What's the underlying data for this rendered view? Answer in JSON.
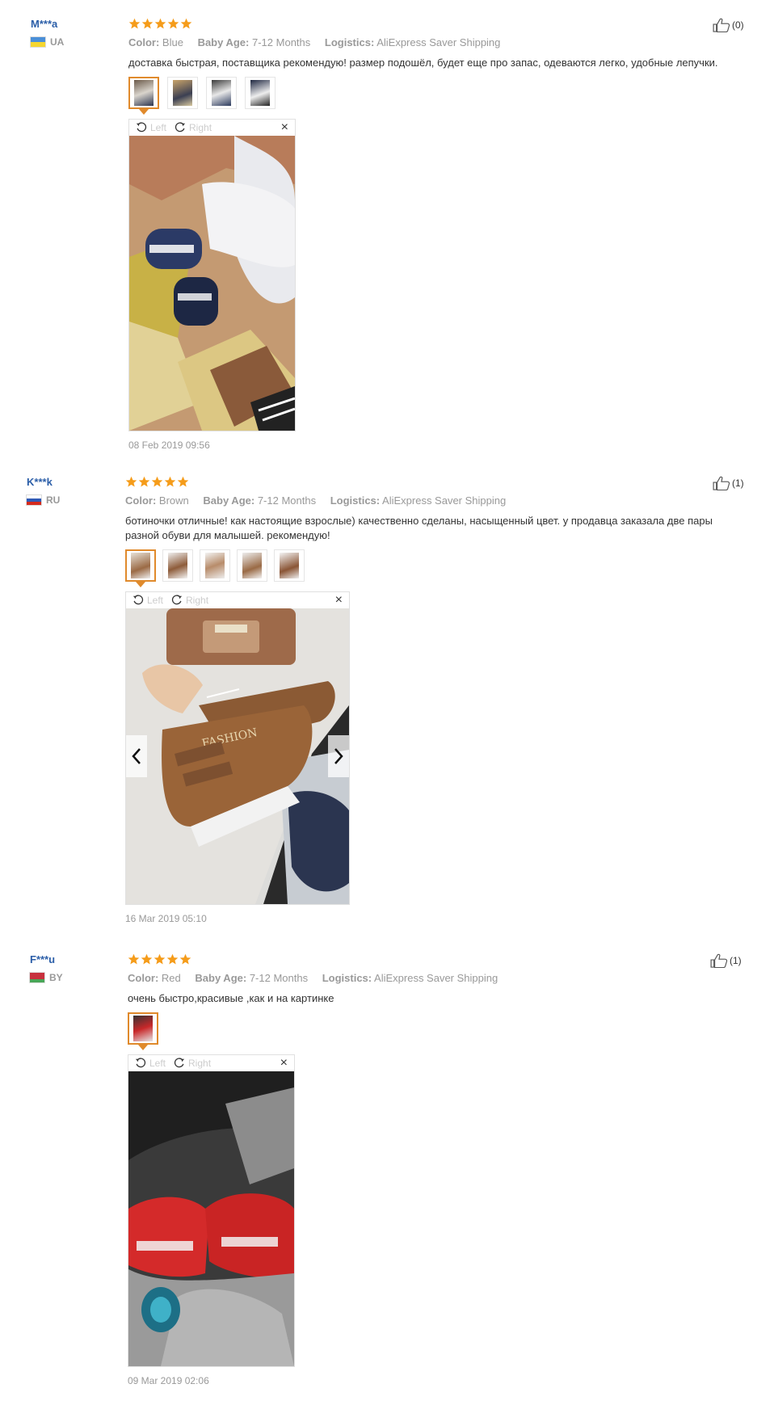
{
  "reviews": [
    {
      "user": "M***a",
      "country": "UA",
      "flag": [
        "#4a8fd8",
        "#f5d630"
      ],
      "stars": 5,
      "attributes": [
        {
          "key": "Color:",
          "value": "Blue"
        },
        {
          "key": "Baby Age:",
          "value": "7-12 Months"
        },
        {
          "key": "Logistics:",
          "value": "AliExpress Saver Shipping"
        }
      ],
      "text": "доставка быстрая, поставщика рекомендую! размер подошёл, будет еще про запас, одеваются легко, удобные лепучки.",
      "thumb_count": 4,
      "viewer": {
        "left": "Left",
        "right": "Right",
        "close": "×"
      },
      "date": "08 Feb 2019 09:56",
      "likes": "(0)"
    },
    {
      "user": "K***k",
      "country": "RU",
      "flag": [
        "#ffffff",
        "#2f5bb7",
        "#d52b1e"
      ],
      "stars": 5,
      "attributes": [
        {
          "key": "Color:",
          "value": "Brown"
        },
        {
          "key": "Baby Age:",
          "value": "7-12 Months"
        },
        {
          "key": "Logistics:",
          "value": "AliExpress Saver Shipping"
        }
      ],
      "text": "ботиночки отличные! как настоящие взрослые) качественно сделаны, насыщенный цвет. у продавца заказала две пары разной обуви для малышей. рекомендую!",
      "thumb_count": 5,
      "viewer": {
        "left": "Left",
        "right": "Right",
        "close": "×"
      },
      "date": "16 Mar 2019 05:10",
      "likes": "(1)"
    },
    {
      "user": "F***u",
      "country": "BY",
      "flag": [
        "#c8313e",
        "#c8313e",
        "#4aa657"
      ],
      "stars": 5,
      "attributes": [
        {
          "key": "Color:",
          "value": "Red"
        },
        {
          "key": "Baby Age:",
          "value": "7-12 Months"
        },
        {
          "key": "Logistics:",
          "value": "AliExpress Saver Shipping"
        }
      ],
      "text": "очень быстро,красивые ,как и на картинке",
      "thumb_count": 1,
      "viewer": {
        "left": "Left",
        "right": "Right",
        "close": "×"
      },
      "date": "09 Mar 2019 02:06",
      "likes": "(1)"
    }
  ],
  "colors": {
    "star": "#f59c1a",
    "active_thumb": "#e08a2c",
    "username": "#2b5ea8"
  }
}
